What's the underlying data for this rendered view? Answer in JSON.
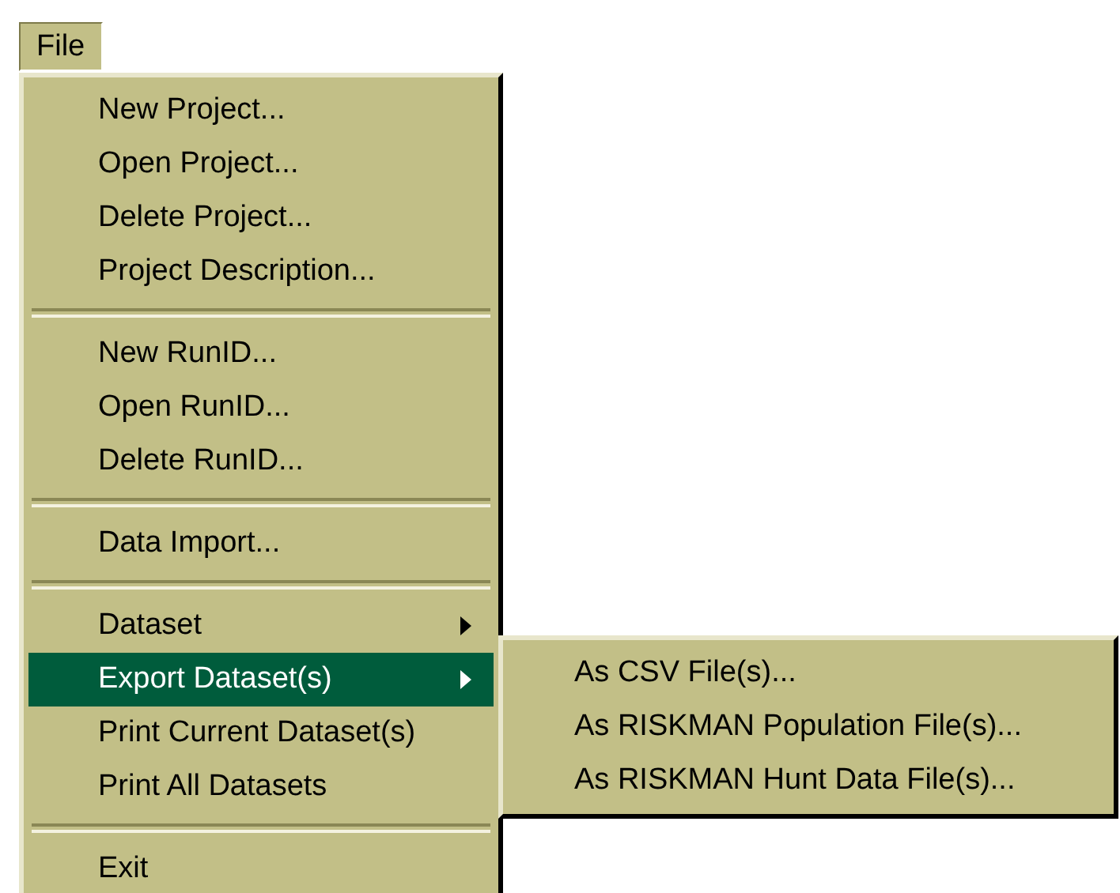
{
  "menubar": [
    {
      "label": "File",
      "selected": true
    }
  ],
  "menu": [
    {
      "kind": "item",
      "label": "New Project...",
      "selected": false,
      "submenu": false
    },
    {
      "kind": "item",
      "label": "Open Project...",
      "selected": false,
      "submenu": false
    },
    {
      "kind": "item",
      "label": "Delete Project...",
      "selected": false,
      "submenu": false
    },
    {
      "kind": "item",
      "label": "Project Description...",
      "selected": false,
      "submenu": false
    },
    {
      "kind": "separator"
    },
    {
      "kind": "item",
      "label": "New RunID...",
      "selected": false,
      "submenu": false
    },
    {
      "kind": "item",
      "label": "Open RunID...",
      "selected": false,
      "submenu": false
    },
    {
      "kind": "item",
      "label": "Delete RunID...",
      "selected": false,
      "submenu": false
    },
    {
      "kind": "separator"
    },
    {
      "kind": "item",
      "label": "Data Import...",
      "selected": false,
      "submenu": false
    },
    {
      "kind": "separator"
    },
    {
      "kind": "item",
      "label": "Dataset",
      "selected": false,
      "submenu": true
    },
    {
      "kind": "item",
      "label": "Export Dataset(s)",
      "selected": true,
      "submenu": true
    },
    {
      "kind": "item",
      "label": "Print Current Dataset(s)",
      "selected": false,
      "submenu": false
    },
    {
      "kind": "item",
      "label": "Print All Datasets",
      "selected": false,
      "submenu": false
    },
    {
      "kind": "separator"
    },
    {
      "kind": "item",
      "label": "Exit",
      "selected": false,
      "submenu": false
    }
  ],
  "submenu": [
    {
      "label": "As CSV File(s)..."
    },
    {
      "label": "As RISKMAN Population File(s)..."
    },
    {
      "label": "As RISKMAN Hunt Data File(s)..."
    }
  ]
}
